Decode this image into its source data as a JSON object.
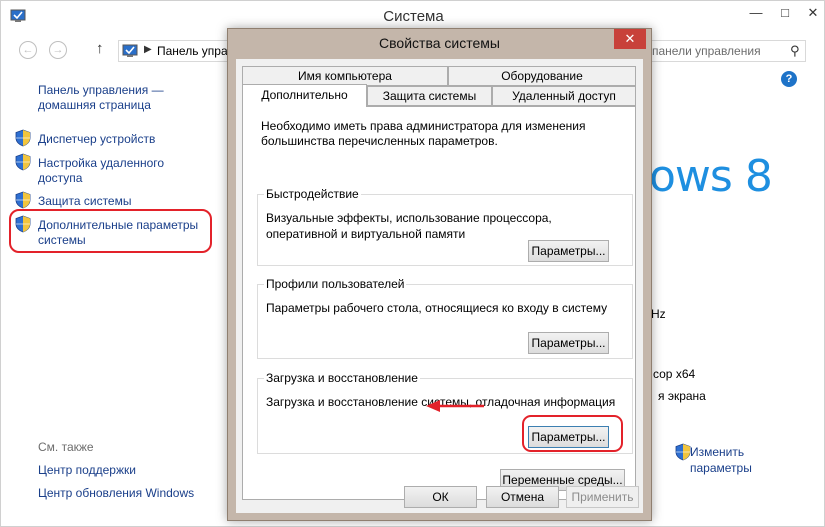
{
  "background_window": {
    "title": "Система",
    "address": "Панель упра",
    "search_placeholder": "панели управления",
    "sidebar": {
      "home_line1": "Панель управления —",
      "home_line2": "домашняя страница",
      "device_manager": "Диспетчер устройств",
      "remote_line1": "Настройка удаленного",
      "remote_line2": "доступа",
      "protection": "Защита системы",
      "advanced_line1": "Дополнительные параметры",
      "advanced_line2": "системы"
    },
    "see_also": {
      "label": "См. также",
      "support_center": "Центр поддержки",
      "windows_update": "Центр обновления Windows"
    },
    "windows_logo_text": "ows 8",
    "info_fragments": {
      "frequency": "Hz",
      "processor": "сор x64",
      "screen": "я экрана"
    },
    "change_line1": "Изменить",
    "change_line2": "параметры"
  },
  "dialog": {
    "title": "Свойства системы",
    "close_glyph": "✕",
    "tabs": {
      "computer_name": "Имя компьютера",
      "hardware": "Оборудование",
      "advanced": "Дополнительно",
      "protection": "Защита системы",
      "remote": "Удаленный доступ"
    },
    "admin_note": "Необходимо иметь права администратора для изменения большинства перечисленных параметров.",
    "performance": {
      "label": "Быстродействие",
      "desc": "Визуальные эффекты, использование процессора, оперативной и виртуальной памяти",
      "button": "Параметры..."
    },
    "profiles": {
      "label": "Профили пользователей",
      "desc": "Параметры рабочего стола, относящиеся ко входу в систему",
      "button": "Параметры..."
    },
    "boot": {
      "label": "Загрузка и восстановление",
      "desc": "Загрузка и восстановление системы, отладочная информация",
      "button": "Параметры..."
    },
    "env_button": "Переменные среды...",
    "ok": "ОК",
    "cancel": "Отмена",
    "apply": "Применить"
  },
  "colors": {
    "link": "#1a3f8a",
    "highlight": "#e3222a",
    "dialog_frame": "#c4b6aa",
    "windows_blue": "#1e8fe0"
  }
}
